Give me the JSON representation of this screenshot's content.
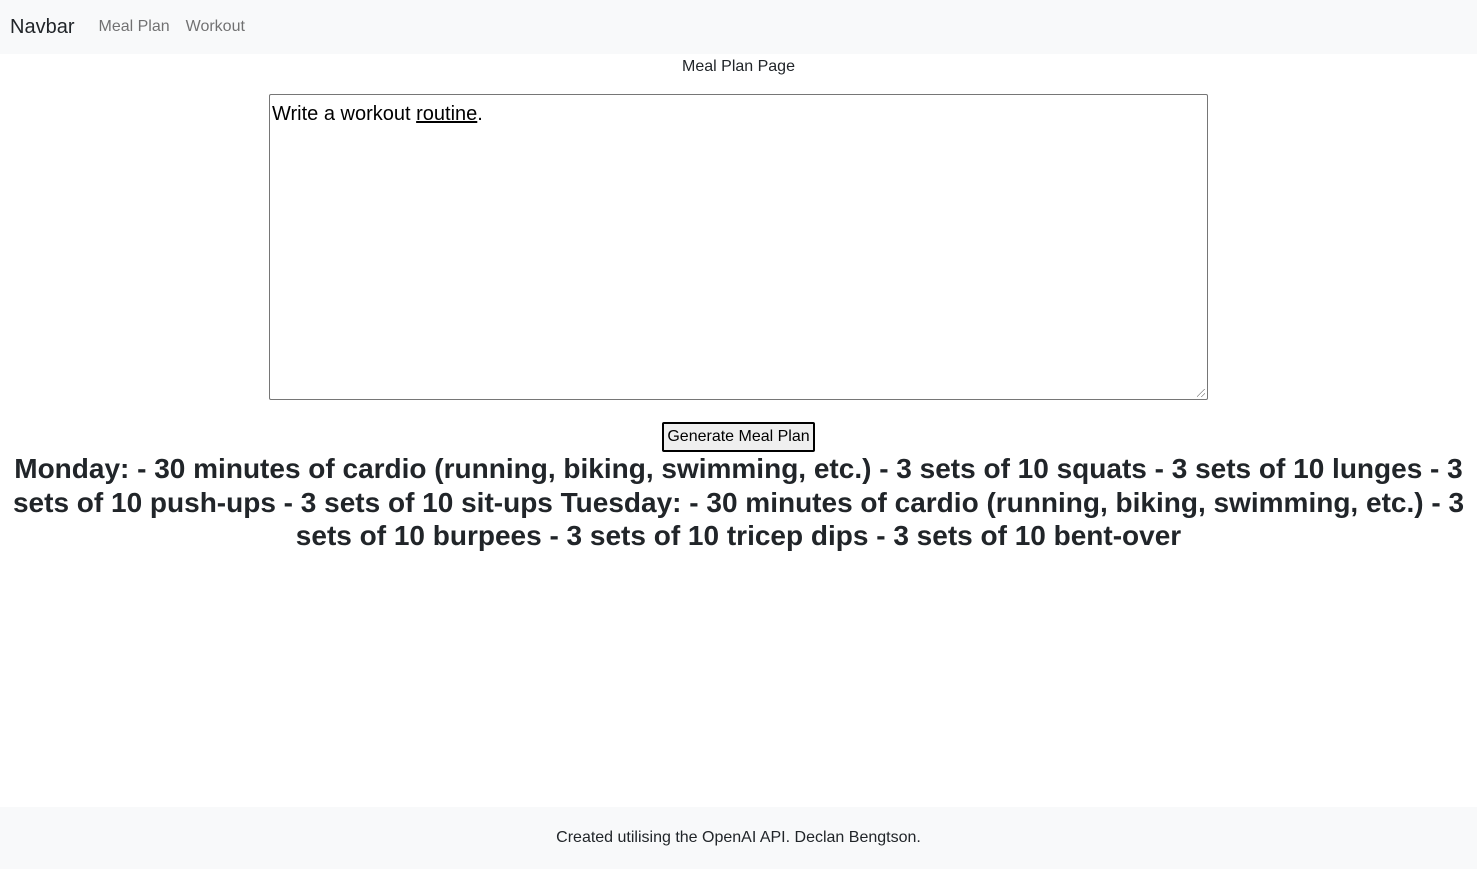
{
  "navbar": {
    "brand": "Navbar",
    "links": [
      {
        "label": "Meal Plan"
      },
      {
        "label": "Workout"
      }
    ]
  },
  "page": {
    "title": "Meal Plan Page"
  },
  "prompt": {
    "text_before": "Write a workout ",
    "text_underlined": "routine",
    "text_after": "."
  },
  "actions": {
    "generate_label": "Generate Meal Plan"
  },
  "result": {
    "text": "Monday: - 30 minutes of cardio (running, biking, swimming, etc.) - 3 sets of 10 squats - 3 sets of 10 lunges - 3 sets of 10 push-ups - 3 sets of 10 sit-ups Tuesday: - 30 minutes of cardio (running, biking, swimming, etc.) - 3 sets of 10 burpees - 3 sets of 10 tricep dips - 3 sets of 10 bent-over"
  },
  "footer": {
    "text": "Created utilising the OpenAI API. Declan Bengtson."
  }
}
